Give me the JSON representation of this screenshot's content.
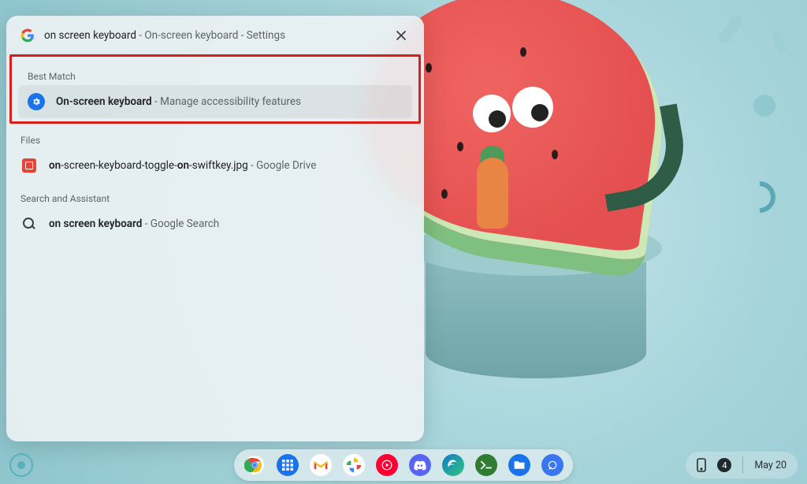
{
  "search": {
    "query": "on screen keyboard",
    "suffix": " - On-screen keyboard - Settings",
    "close_aria": "Close"
  },
  "sections": {
    "best_match": "Best Match",
    "files": "Files",
    "search_assistant": "Search and Assistant"
  },
  "results": {
    "best_match": {
      "title": "On-screen keyboard",
      "subtitle": " - Manage accessibility features",
      "icon": "settings-gear-icon"
    },
    "file": {
      "title_parts": [
        "on",
        "-screen-keyboard-toggle-",
        "on",
        "-swiftkey.jpg"
      ],
      "subtitle": " - Google Drive",
      "icon": "drive-image-icon"
    },
    "web": {
      "title": "on screen keyboard",
      "subtitle": " - Google Search",
      "icon": "search-icon"
    }
  },
  "shelf": {
    "apps": [
      {
        "name": "chrome",
        "color1": "#ea4335",
        "color2": "#4285f4",
        "label": "Chrome"
      },
      {
        "name": "app-launcher-grid",
        "color1": "#1a73e8",
        "label": "Apps"
      },
      {
        "name": "gmail",
        "color1": "#ea4335",
        "label": "Gmail"
      },
      {
        "name": "photos",
        "color1": "#fbbc04",
        "label": "Photos"
      },
      {
        "name": "youtube-music",
        "color1": "#ff0033",
        "label": "YT Music"
      },
      {
        "name": "discord",
        "color1": "#5865f2",
        "label": "Discord"
      },
      {
        "name": "edge",
        "color1": "#0f7bc4",
        "label": "Edge"
      },
      {
        "name": "terminal",
        "color1": "#2e7d32",
        "label": "Terminal"
      },
      {
        "name": "files",
        "color1": "#1a73e8",
        "label": "Files"
      },
      {
        "name": "signal",
        "color1": "#3a76f0",
        "label": "Signal"
      }
    ]
  },
  "tray": {
    "notification_count": "4",
    "date": "May 20"
  }
}
